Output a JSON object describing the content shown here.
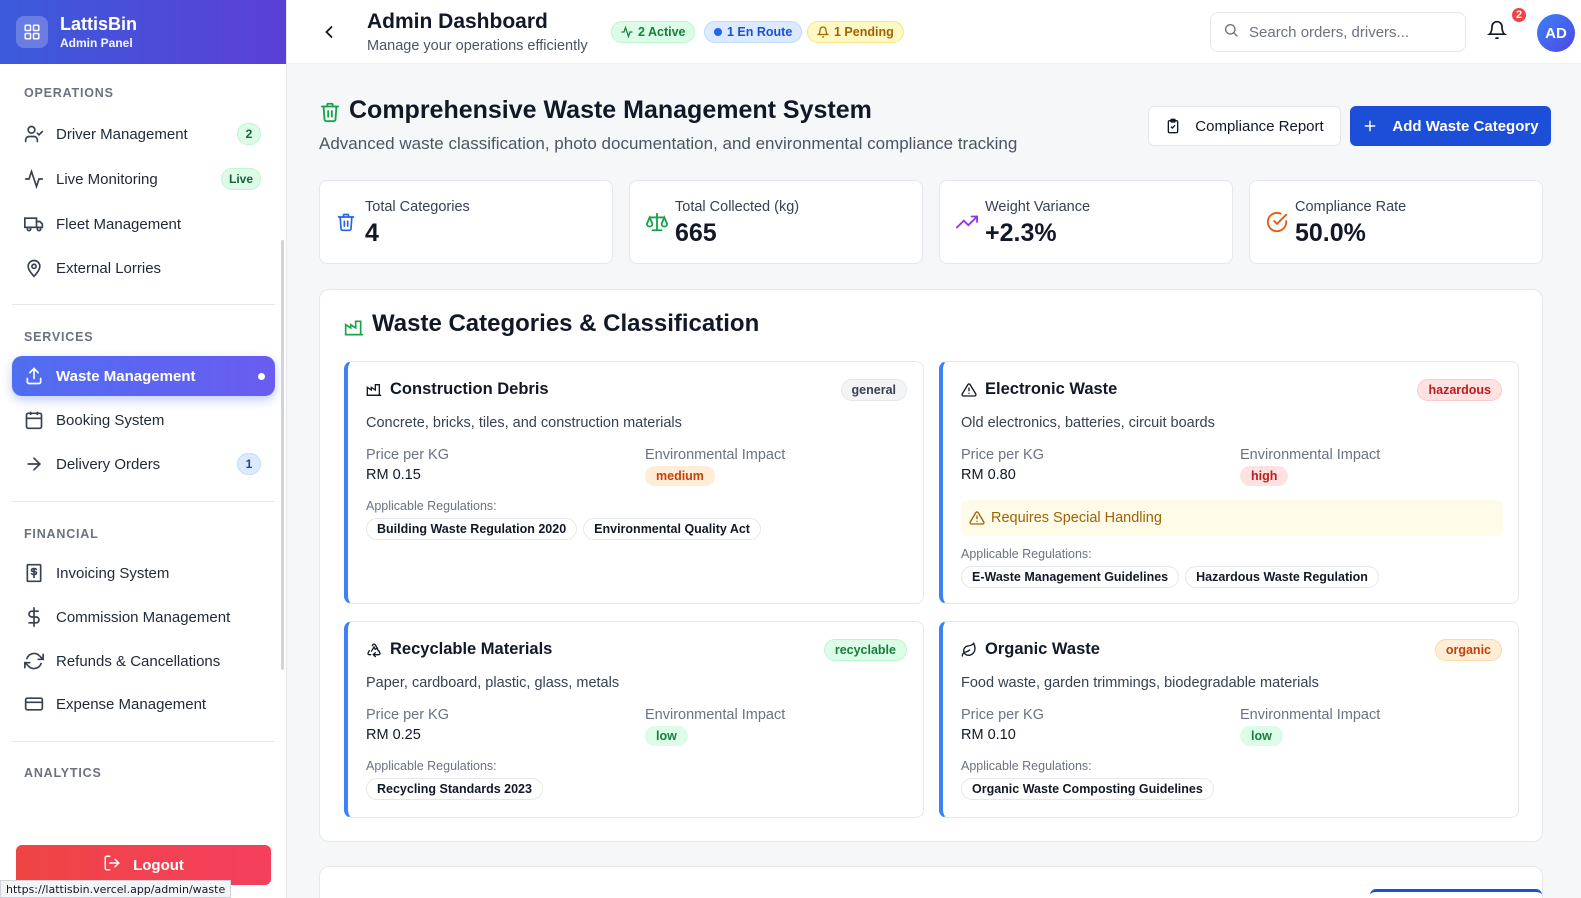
{
  "brand": {
    "name": "LattisBin",
    "subtitle": "Admin Panel"
  },
  "sidebar": {
    "sections": [
      {
        "title": "OPERATIONS"
      },
      {
        "title": "SERVICES"
      },
      {
        "title": "FINANCIAL"
      },
      {
        "title": "ANALYTICS"
      }
    ],
    "items": [
      {
        "label": "Driver Management",
        "icon": "user-check-icon",
        "badge": "2"
      },
      {
        "label": "Live Monitoring",
        "icon": "activity-icon",
        "badge": "Live"
      },
      {
        "label": "Fleet Management",
        "icon": "truck-icon"
      },
      {
        "label": "External Lorries",
        "icon": "map-pin-icon"
      },
      {
        "label": "Waste Management",
        "icon": "upload-icon",
        "active": true
      },
      {
        "label": "Booking System",
        "icon": "calendar-icon"
      },
      {
        "label": "Delivery Orders",
        "icon": "arrow-right-icon",
        "badge": "1"
      },
      {
        "label": "Invoicing System",
        "icon": "receipt-icon"
      },
      {
        "label": "Commission Management",
        "icon": "dollar-icon"
      },
      {
        "label": "Refunds & Cancellations",
        "icon": "refresh-icon"
      },
      {
        "label": "Expense Management",
        "icon": "credit-card-icon"
      }
    ],
    "logout_label": "Logout"
  },
  "status_url": "https://lattisbin.vercel.app/admin/waste",
  "header": {
    "title": "Admin Dashboard",
    "subtitle": "Manage your operations efficiently",
    "pills": {
      "active": "2 Active",
      "en_route": "1 En Route",
      "pending": "1 Pending"
    },
    "search_placeholder": "Search orders, drivers...",
    "notification_count": "2",
    "avatar_initials": "AD"
  },
  "page": {
    "title": "Comprehensive Waste Management System",
    "subtitle": "Advanced waste classification, photo documentation, and environmental compliance tracking",
    "compliance_button": "Compliance Report",
    "add_button": "Add Waste Category"
  },
  "stats": [
    {
      "label": "Total Categories",
      "value": "4",
      "icon": "trash-icon",
      "color": "#2563eb"
    },
    {
      "label": "Total Collected (kg)",
      "value": "665",
      "icon": "scale-icon",
      "color": "#16a34a"
    },
    {
      "label": "Weight Variance",
      "value": "+2.3%",
      "icon": "trending-up-icon",
      "color": "#9333ea"
    },
    {
      "label": "Compliance Rate",
      "value": "50.0%",
      "icon": "check-circle-icon",
      "color": "#ea580c"
    }
  ],
  "categories_panel": {
    "title": "Waste Categories & Classification",
    "price_label": "Price per KG",
    "impact_label": "Environmental Impact",
    "regulations_label": "Applicable Regulations:",
    "special_handling": "Requires Special Handling",
    "categories": [
      {
        "name": "Construction Debris",
        "tag": "general",
        "description": "Concrete, bricks, tiles, and construction materials",
        "price": "RM 0.15",
        "impact": "medium",
        "regulations": [
          "Building Waste Regulation 2020",
          "Environmental Quality Act"
        ]
      },
      {
        "name": "Electronic Waste",
        "tag": "hazardous",
        "description": "Old electronics, batteries, circuit boards",
        "price": "RM 0.80",
        "impact": "high",
        "regulations": [
          "E-Waste Management Guidelines",
          "Hazardous Waste Regulation"
        ]
      },
      {
        "name": "Recyclable Materials",
        "tag": "recyclable",
        "description": "Paper, cardboard, plastic, glass, metals",
        "price": "RM 0.25",
        "impact": "low",
        "regulations": [
          "Recycling Standards 2023"
        ]
      },
      {
        "name": "Organic Waste",
        "tag": "organic",
        "description": "Food waste, garden trimmings, biodegradable materials",
        "price": "RM 0.10",
        "impact": "low",
        "regulations": [
          "Organic Waste Composting Guidelines"
        ]
      }
    ]
  }
}
